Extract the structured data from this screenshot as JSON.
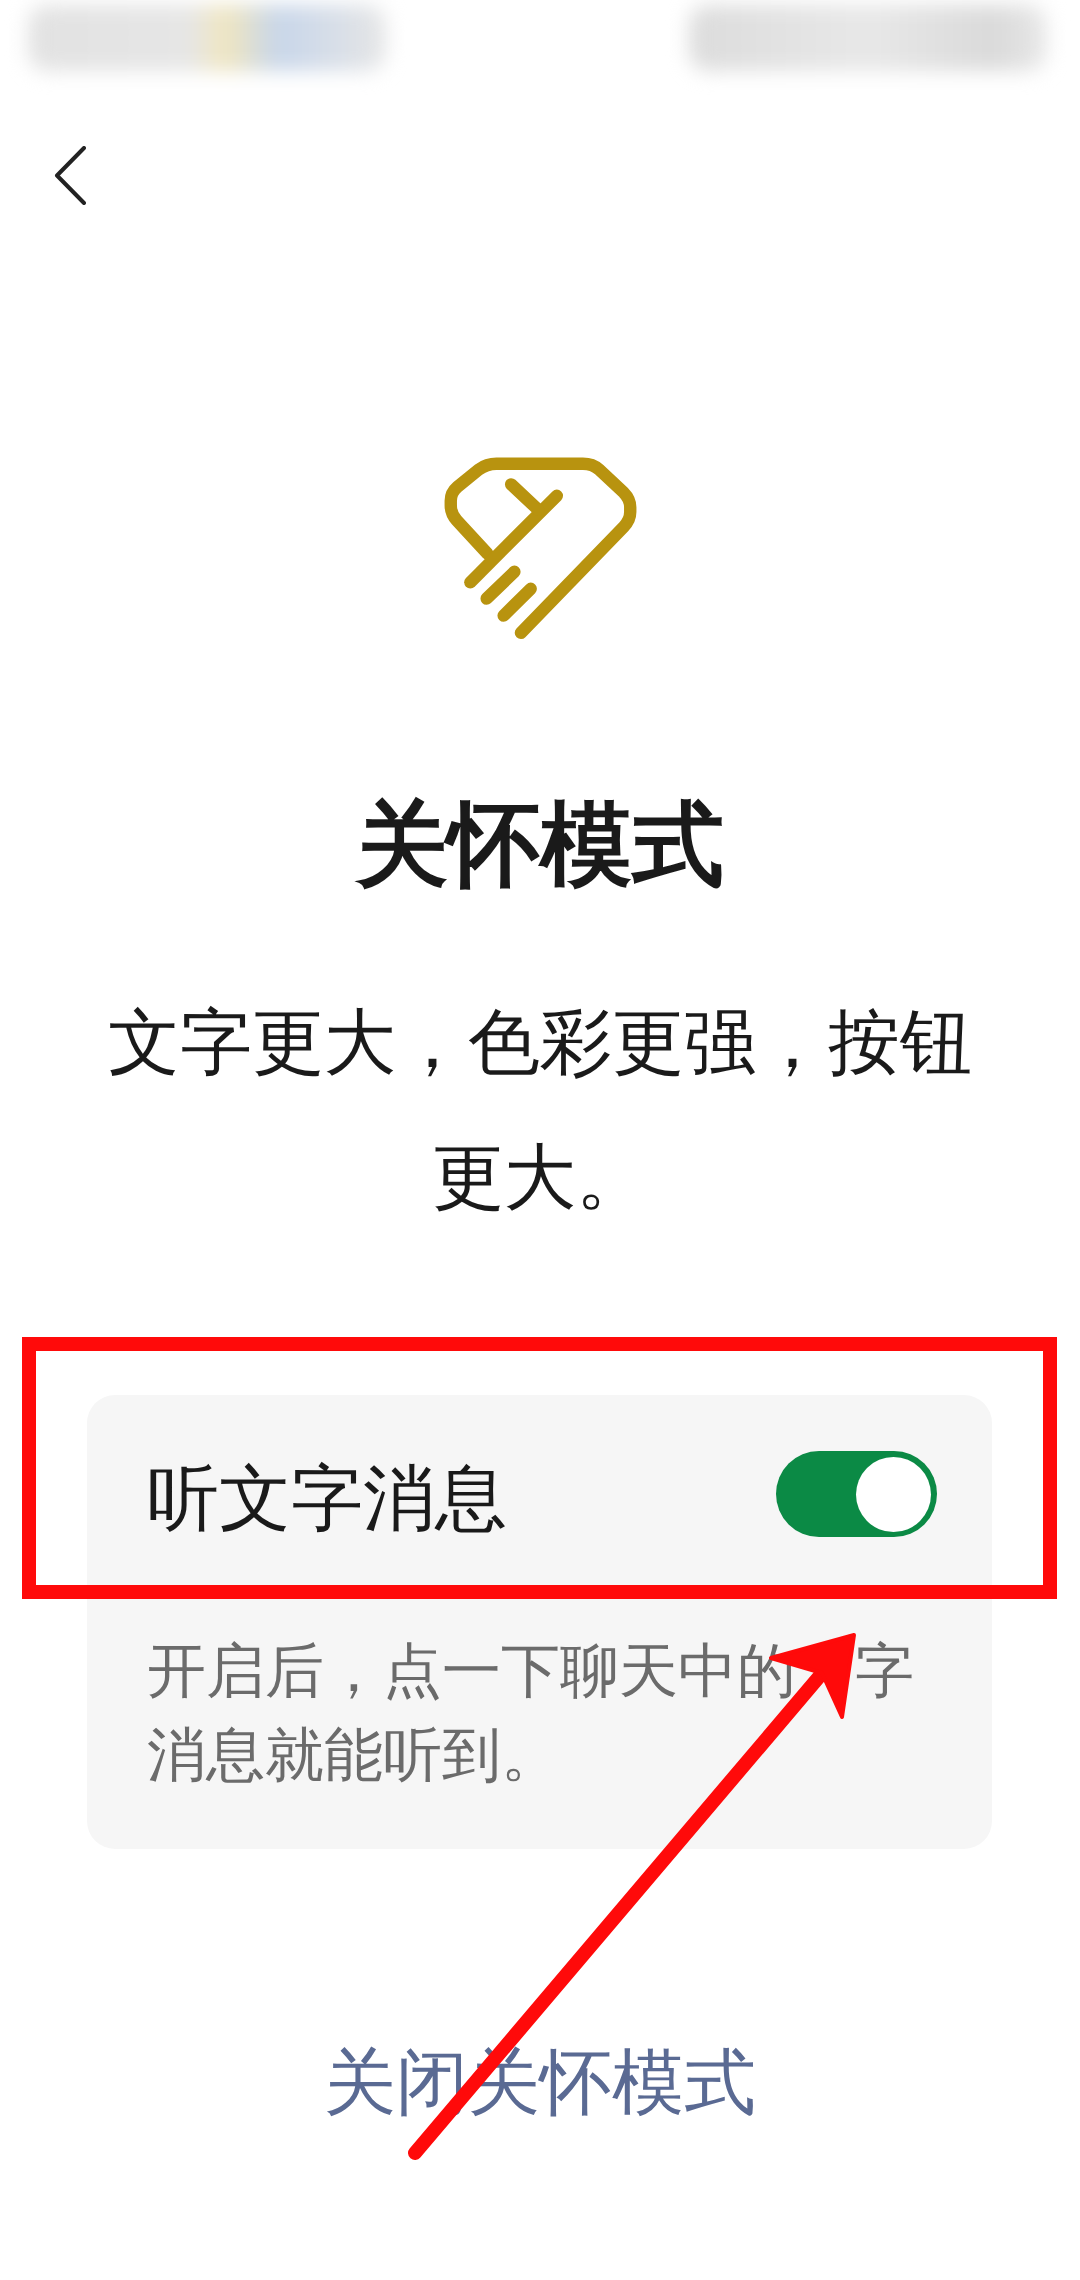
{
  "title": "关怀模式",
  "subtitle": "文字更大，色彩更强，按钮更大。",
  "setting": {
    "label": "听文字消息",
    "on": true,
    "description_parts": [
      "开启后，点一下聊天中的",
      "字消息就能听到。"
    ]
  },
  "exit_link": "关闭关怀模式"
}
